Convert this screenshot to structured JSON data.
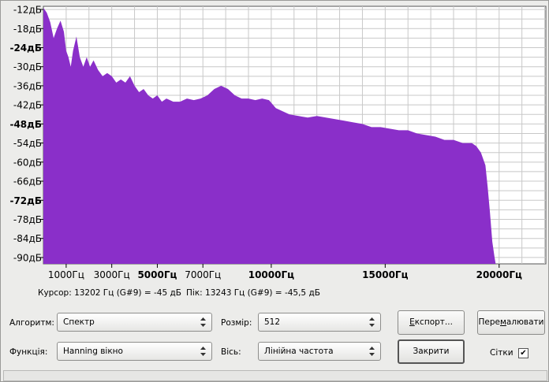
{
  "plot": {
    "y_ticks": [
      {
        "label": "-12дБ",
        "value": -12,
        "bold": false
      },
      {
        "label": "-18дБ",
        "value": -18,
        "bold": false
      },
      {
        "label": "-24дБ",
        "value": -24,
        "bold": true
      },
      {
        "label": "-30дБ",
        "value": -30,
        "bold": false
      },
      {
        "label": "-36дБ",
        "value": -36,
        "bold": false
      },
      {
        "label": "-42дБ",
        "value": -42,
        "bold": false
      },
      {
        "label": "-48дБ",
        "value": -48,
        "bold": true
      },
      {
        "label": "-54дБ",
        "value": -54,
        "bold": false
      },
      {
        "label": "-60дБ",
        "value": -60,
        "bold": false
      },
      {
        "label": "-66дБ",
        "value": -66,
        "bold": false
      },
      {
        "label": "-72дБ",
        "value": -72,
        "bold": true
      },
      {
        "label": "-78дБ",
        "value": -78,
        "bold": false
      },
      {
        "label": "-84дБ",
        "value": -84,
        "bold": false
      },
      {
        "label": "-90дБ",
        "value": -90,
        "bold": false
      }
    ],
    "x_ticks": [
      {
        "label": "1000Гц",
        "value": 1000,
        "bold": false
      },
      {
        "label": "3000Гц",
        "value": 3000,
        "bold": false
      },
      {
        "label": "5000Гц",
        "value": 5000,
        "bold": true
      },
      {
        "label": "7000Гц",
        "value": 7000,
        "bold": false
      },
      {
        "label": "10000Гц",
        "value": 10000,
        "bold": true
      },
      {
        "label": "15000Гц",
        "value": 15000,
        "bold": true
      },
      {
        "label": "20000Гц",
        "value": 20000,
        "bold": true
      }
    ],
    "fill_color": "#8a2fc9",
    "grid_color": "#c8c8c8"
  },
  "chart_data": {
    "type": "area",
    "xlabel": "",
    "ylabel": "",
    "xlim": [
      0,
      22050
    ],
    "ylim": [
      -92,
      -11
    ],
    "grid": true,
    "series": [
      {
        "x": [
          0,
          150,
          300,
          450,
          600,
          750,
          900,
          1000,
          1100,
          1200,
          1300,
          1450,
          1600,
          1750,
          1900,
          2050,
          2200,
          2400,
          2600,
          2800,
          3000,
          3200,
          3400,
          3600,
          3800,
          4000,
          4200,
          4400,
          4600,
          4800,
          5000,
          5200,
          5400,
          5700,
          6000,
          6300,
          6600,
          6900,
          7200,
          7500,
          7800,
          8100,
          8400,
          8700,
          9000,
          9300,
          9600,
          9900,
          10200,
          10500,
          10800,
          11200,
          11600,
          12000,
          12400,
          12800,
          13200,
          13600,
          14000,
          14400,
          14800,
          15200,
          15600,
          16000,
          16400,
          16800,
          17200,
          17600,
          18000,
          18400,
          18800,
          19000,
          19200,
          19400,
          19500,
          19600,
          19700,
          19800,
          19850
        ],
        "y": [
          -11.5,
          -13,
          -16,
          -21,
          -18,
          -15.5,
          -19,
          -25,
          -27,
          -30,
          -25,
          -20.5,
          -27,
          -30,
          -27,
          -30,
          -28,
          -31,
          -33,
          -32,
          -33,
          -35,
          -34,
          -35,
          -33,
          -36,
          -38,
          -37,
          -39,
          -40,
          -39,
          -41,
          -40,
          -41,
          -41,
          -40,
          -40.5,
          -40,
          -39,
          -37,
          -36,
          -37,
          -39,
          -40,
          -40,
          -40.5,
          -40,
          -40.5,
          -43,
          -44,
          -45,
          -45.5,
          -46,
          -45.5,
          -46,
          -46.5,
          -47,
          -47.5,
          -48,
          -49,
          -49,
          -49.5,
          -50,
          -50,
          -51,
          -51.5,
          -52,
          -53,
          -53,
          -54,
          -54,
          -55,
          -57,
          -61,
          -68,
          -76,
          -85,
          -90,
          -92
        ]
      }
    ]
  },
  "info": {
    "cursor": "Курсор: 13202 Гц (G#9) = -45 дБ",
    "peak": "Пік: 13243 Гц (G#9) = -45,5 дБ"
  },
  "controls": {
    "algorithm_label": "Алгоритм:",
    "algorithm_value": "Спектр",
    "size_label": "Розмір:",
    "size_value": "512",
    "export_prefix": "",
    "export_key": "Е",
    "export_rest": "кспорт...",
    "redraw_prefix": "Пере",
    "redraw_key": "м",
    "redraw_rest": "алювати",
    "function_label": "Функція:",
    "function_value": "Hanning вікно",
    "axis_label": "Вісь:",
    "axis_value": "Лінійна частота",
    "close_label": "Закрити",
    "grid_label": "Сітки",
    "grid_checked": "✔"
  }
}
